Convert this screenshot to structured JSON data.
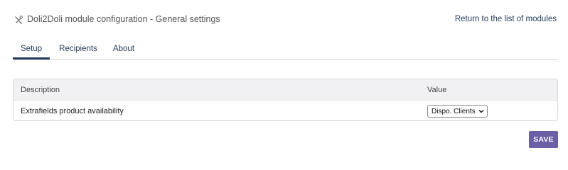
{
  "header": {
    "title": "Doli2Doli module configuration - General settings",
    "return_link": "Return to the list of modules",
    "icon": "tools-icon"
  },
  "tabs": [
    {
      "label": "Setup",
      "active": true
    },
    {
      "label": "Recipients",
      "active": false
    },
    {
      "label": "About",
      "active": false
    }
  ],
  "table": {
    "columns": [
      "Description",
      "Value"
    ],
    "rows": [
      {
        "description": "Extrafields product availability",
        "value": "Dispo. Clients"
      }
    ]
  },
  "save_label": "SAVE",
  "colors": {
    "link": "#263c5c",
    "save_button": "#6b5fa6",
    "header_bg": "#f1f1f3"
  }
}
